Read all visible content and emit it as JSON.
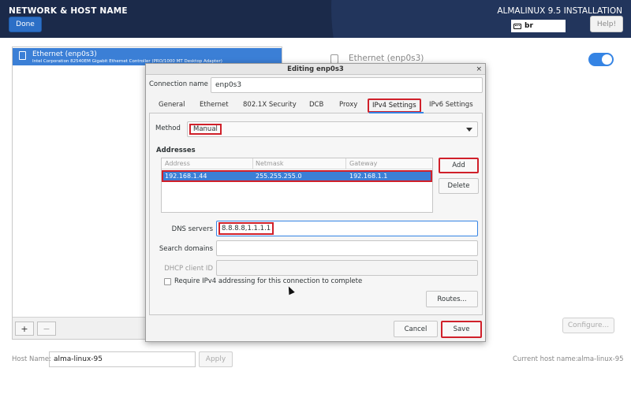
{
  "header": {
    "title": "NETWORK & HOST NAME",
    "done_label": "Done",
    "install_title": "ALMALINUX 9.5 INSTALLATION",
    "keyboard_layout": "br",
    "help_label": "Help!"
  },
  "interfaces": {
    "items": [
      {
        "name": "Ethernet (enp0s3)",
        "description": "Intel Corporation 82540EM Gigabit Ethernet Controller (PRO/1000 MT Desktop Adapter)"
      }
    ],
    "add_label": "+",
    "remove_label": "−"
  },
  "detail": {
    "name": "Ethernet (enp0s3)",
    "configure_label": "Configure..."
  },
  "hostname": {
    "label": "Host Name:",
    "value": "alma-linux-95",
    "apply_label": "Apply",
    "current_label": "Current host name:",
    "current_value": "alma-linux-95"
  },
  "dialog": {
    "title": "Editing enp0s3",
    "close_glyph": "×",
    "connection_name_label": "Connection name",
    "connection_name_value": "enp0s3",
    "tabs": [
      {
        "label": "General"
      },
      {
        "label": "Ethernet"
      },
      {
        "label": "802.1X Security"
      },
      {
        "label": "DCB"
      },
      {
        "label": "Proxy"
      },
      {
        "label": "IPv4 Settings",
        "active": true
      },
      {
        "label": "IPv6 Settings"
      }
    ],
    "method_label": "Method",
    "method_value": "Manual",
    "addresses_heading": "Addresses",
    "address_columns": [
      "Address",
      "Netmask",
      "Gateway"
    ],
    "address_rows": [
      {
        "address": "192.168.1.44",
        "netmask": "255.255.255.0",
        "gateway": "192.168.1.1"
      }
    ],
    "add_label": "Add",
    "delete_label": "Delete",
    "dns_label": "DNS servers",
    "dns_value": "8.8.8.8,1.1.1.1",
    "search_label": "Search domains",
    "search_value": "",
    "dhcp_label": "DHCP client ID",
    "dhcp_value": "",
    "require_label": "Require IPv4 addressing for this connection to complete",
    "require_checked": false,
    "routes_label": "Routes...",
    "cancel_label": "Cancel",
    "save_label": "Save"
  },
  "colors": {
    "header_bg": "#1b2a4a",
    "accent": "#3584e4",
    "highlight": "#d0202a"
  }
}
